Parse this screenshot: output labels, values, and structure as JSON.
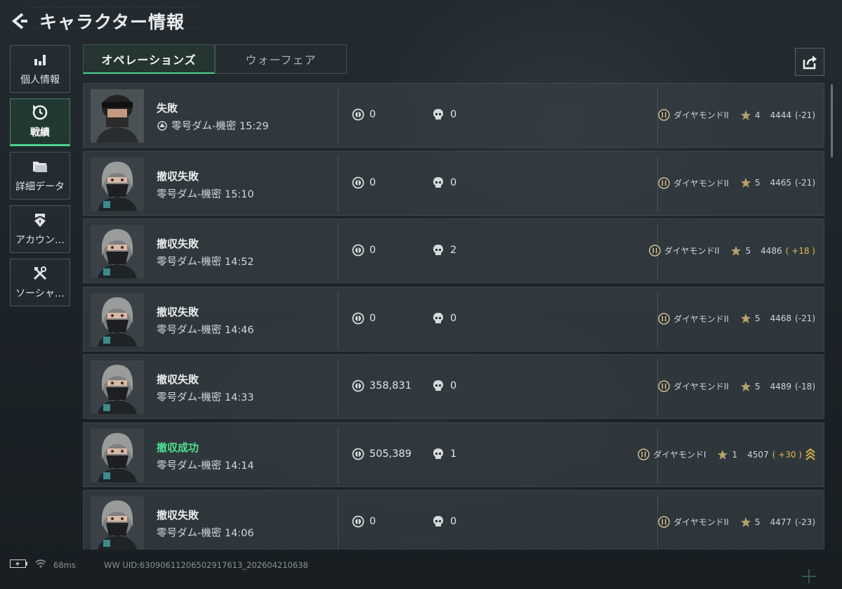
{
  "header": {
    "title": "キャラクター情報"
  },
  "sidebar": {
    "items": [
      {
        "label": "個人情報",
        "icon": "bar-chart-icon",
        "active": false
      },
      {
        "label": "戦績",
        "icon": "clock-icon",
        "active": true
      },
      {
        "label": "詳細データ",
        "icon": "folder-icon",
        "active": false
      },
      {
        "label": "アカウン…",
        "icon": "badge-icon",
        "active": false
      },
      {
        "label": "ソーシャ…",
        "icon": "tools-icon",
        "active": false
      }
    ]
  },
  "tabs": [
    {
      "label": "オペレーションズ",
      "active": true
    },
    {
      "label": "ウォーフェア",
      "active": false
    }
  ],
  "matches": [
    {
      "result": "失敗",
      "success": false,
      "map": "零号ダム-機密 15:29",
      "has_map_icon": true,
      "money": "0",
      "kills": "0",
      "rank": "ダイヤモンドII",
      "stars": "4",
      "score": "4444",
      "delta": "(-21)",
      "delta_positive": false,
      "promo": false
    },
    {
      "result": "撤収失敗",
      "success": false,
      "map": "零号ダム-機密 15:10",
      "has_map_icon": false,
      "money": "0",
      "kills": "0",
      "rank": "ダイヤモンドII",
      "stars": "5",
      "score": "4465",
      "delta": "(-21)",
      "delta_positive": false,
      "promo": false
    },
    {
      "result": "撤収失敗",
      "success": false,
      "map": "零号ダム-機密 14:52",
      "has_map_icon": false,
      "money": "0",
      "kills": "2",
      "rank": "ダイヤモンドII",
      "stars": "5",
      "score": "4486",
      "delta": "( +18 )",
      "delta_positive": true,
      "promo": false
    },
    {
      "result": "撤収失敗",
      "success": false,
      "map": "零号ダム-機密 14:46",
      "has_map_icon": false,
      "money": "0",
      "kills": "0",
      "rank": "ダイヤモンドII",
      "stars": "5",
      "score": "4468",
      "delta": "(-21)",
      "delta_positive": false,
      "promo": false
    },
    {
      "result": "撤収失敗",
      "success": false,
      "map": "零号ダム-機密 14:33",
      "has_map_icon": false,
      "money": "358,831",
      "kills": "0",
      "rank": "ダイヤモンドII",
      "stars": "5",
      "score": "4489",
      "delta": "(-18)",
      "delta_positive": false,
      "promo": false
    },
    {
      "result": "撤収成功",
      "success": true,
      "map": "零号ダム-機密 14:14",
      "has_map_icon": false,
      "money": "505,389",
      "kills": "1",
      "rank": "ダイヤモンドI",
      "stars": "1",
      "score": "4507",
      "delta": "( +30 )",
      "delta_positive": true,
      "promo": true
    },
    {
      "result": "撤収失敗",
      "success": false,
      "map": "零号ダム-機密 14:06",
      "has_map_icon": false,
      "money": "0",
      "kills": "0",
      "rank": "ダイヤモンドII",
      "stars": "5",
      "score": "4477",
      "delta": "(-23)",
      "delta_positive": false,
      "promo": false
    }
  ],
  "footer": {
    "ping": "68ms",
    "uid": "WW UID:6309061120650291761​3_202604210638"
  },
  "colors": {
    "accent": "#4fd18f",
    "gold": "#e8b84c",
    "row_bg": "#343d43"
  }
}
